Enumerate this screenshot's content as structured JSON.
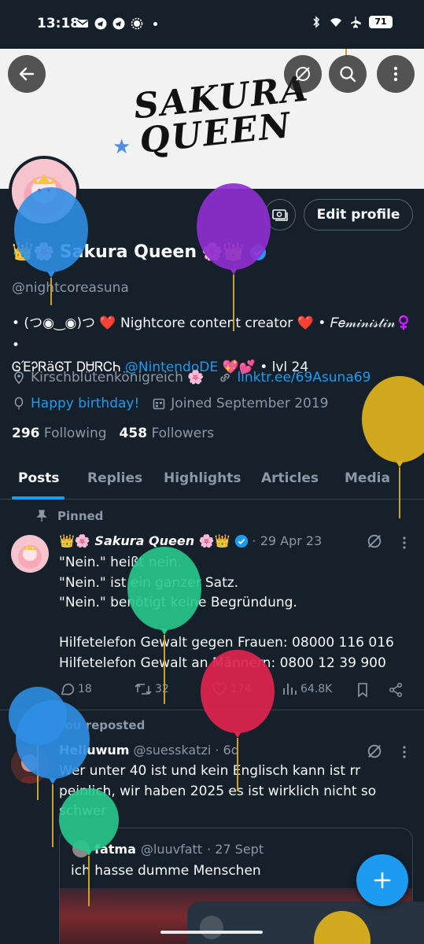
{
  "status_bar": {
    "time": "13:18",
    "battery": "71"
  },
  "banner": {
    "line1": "SAKURA",
    "line2": "QUEEN"
  },
  "profile": {
    "edit_label": "Edit profile",
    "name_prefix": "👑🌸",
    "name": "Sakura Queen",
    "name_suffix": "🌸👑",
    "handle": "@nightcoreasuna",
    "bio_line1": "• (つ◉‿◉)つ ❤️ Nightcore content creator ❤️ • 𝐹𝑒𝓂𝒾𝓃𝒾𝓈𝓉𝒾𝓃♀️ •",
    "bio_line2_pre": "ᎶΈᎮᏒäᎶᎢ ᎠᏌᏒᏟᏂ",
    "bio_mention": "@NintendoDE",
    "bio_line2_post": "💖💕 • lvl 24",
    "location": "Kirschblütenkönigreich 🌸",
    "website": "linktr.ee/69Asuna69",
    "birthday": "Happy birthday!",
    "joined": "Joined September 2019",
    "following_count": "296",
    "following_label": "Following",
    "followers_count": "458",
    "followers_label": "Followers"
  },
  "tabs": [
    "Posts",
    "Replies",
    "Highlights",
    "Articles",
    "Media"
  ],
  "pinned_label": "Pinned",
  "post1": {
    "name": "👑🌸 𝙎𝙖𝙠𝙪𝙧𝙖 𝙌𝙪𝙚𝙚𝙣 🌸👑",
    "meta": "· 29 Apr 23",
    "text": "\"Nein.\" heißt nein.\n\"Nein.\" ist ein ganzer Satz.\n\"Nein.\" benötigt keine Begründung.\n\nHilfetelefon Gewalt gegen Frauen: 08000 116 016\nHilfetelefon Gewalt an Männern: 0800 12 39 900",
    "replies": "18",
    "reposts": "32",
    "likes": "174",
    "views": "64.8K"
  },
  "repost_label": "You reposted",
  "post2": {
    "name": "Heliuwum",
    "handle": "@suesskatzi",
    "time": "· 6d",
    "text": "Wer unter 40 ist und kein Englisch kann ist rr peinlich, wir haben 2025 es ist wirklich nicht so schwer",
    "quote_name": "fatma",
    "quote_handle": "@luuvfatt",
    "quote_time": "· 27 Sept",
    "quote_text": "ich hasse dumme Menschen"
  },
  "colors": {
    "accent": "#1d9bf0",
    "background": "#15202b",
    "like": "#f91880"
  },
  "balloon_colors": [
    "#2f8fe6",
    "#8e2fd0",
    "#e0b41c",
    "#27c98c",
    "#e0244e",
    "#2f8fe6",
    "#2f8fe6",
    "#27c98c",
    "#e0b41c"
  ]
}
